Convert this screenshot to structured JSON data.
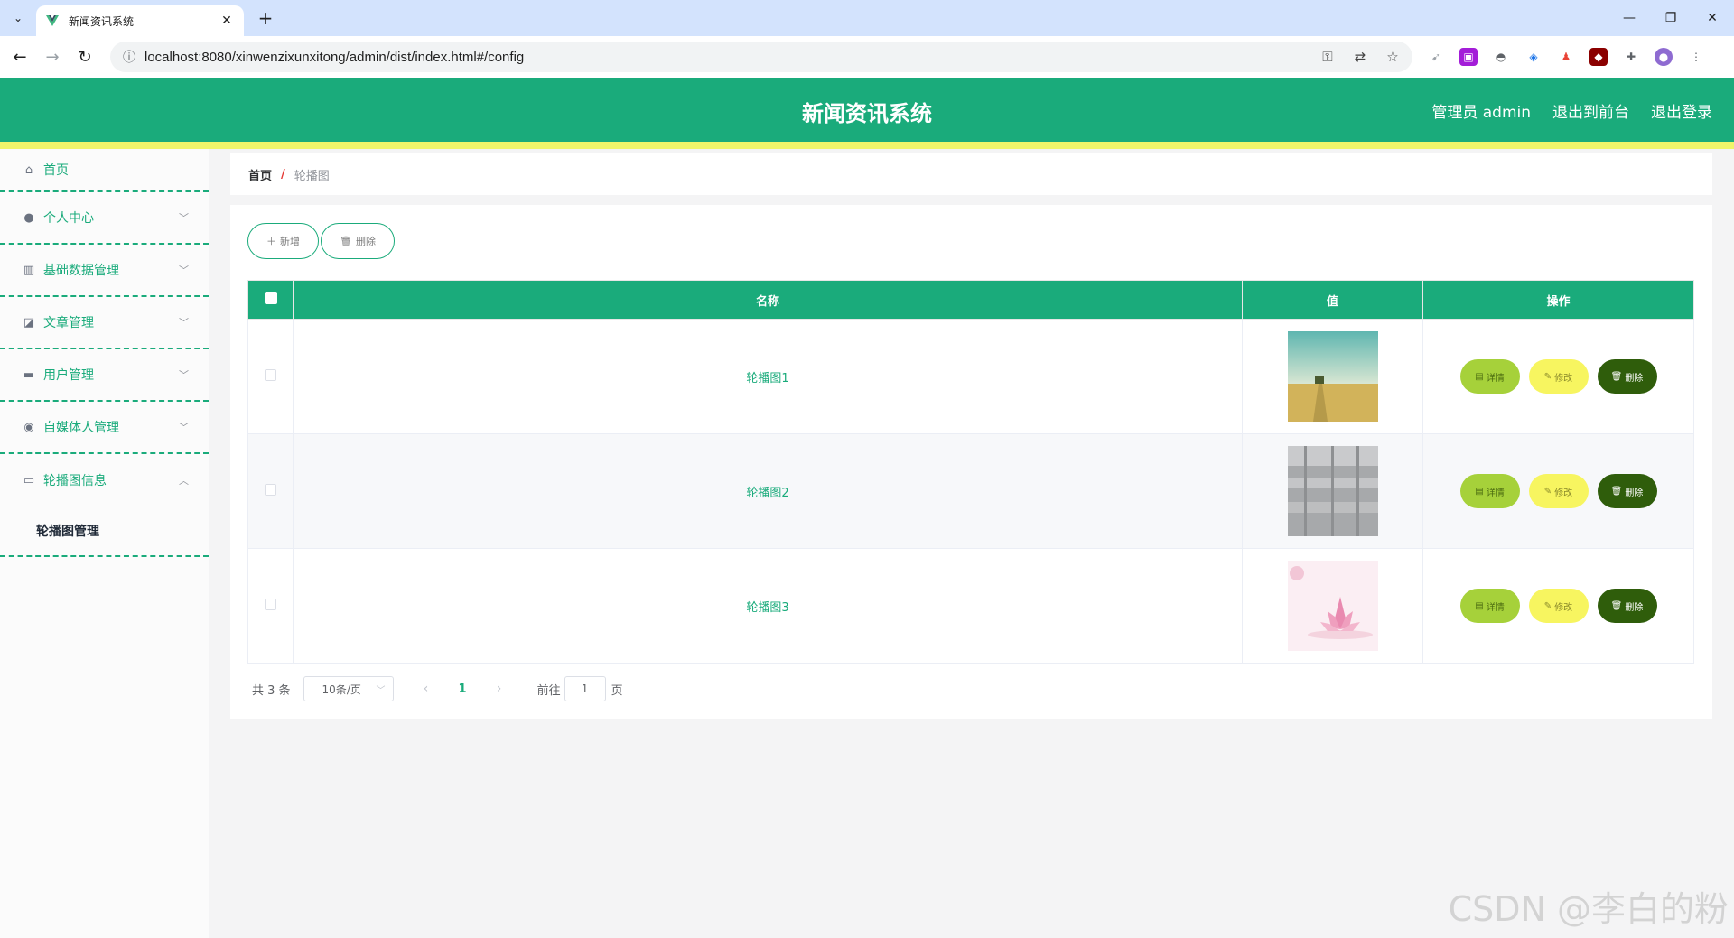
{
  "browser": {
    "tab_title": "新闻资讯系统",
    "url": "localhost:8080/xinwenzixunxitong/admin/dist/index.html#/config"
  },
  "header": {
    "title": "新闻资讯系统",
    "user_label": "管理员 admin",
    "to_front_label": "退出到前台",
    "logout_label": "退出登录",
    "color": "#1aab7b",
    "stripe_color": "#f0f56b"
  },
  "sidebar": {
    "items": [
      {
        "label": "首页",
        "icon": "home-icon"
      },
      {
        "label": "个人中心",
        "icon": "user-icon"
      },
      {
        "label": "基础数据管理",
        "icon": "library-icon"
      },
      {
        "label": "文章管理",
        "icon": "chart-icon"
      },
      {
        "label": "用户管理",
        "icon": "chat-icon"
      },
      {
        "label": "自媒体人管理",
        "icon": "bulb-icon"
      },
      {
        "label": "轮播图信息",
        "icon": "banner-icon"
      }
    ],
    "submenu_label": "轮播图管理"
  },
  "breadcrumb": {
    "home": "首页",
    "separator": "/",
    "current": "轮播图"
  },
  "toolbar": {
    "add_label": "新增",
    "delete_label": "删除"
  },
  "table": {
    "columns": [
      "名称",
      "值",
      "操作"
    ],
    "rows": [
      {
        "name": "轮播图1",
        "image": "field-image"
      },
      {
        "name": "轮播图2",
        "image": "waterfall-image"
      },
      {
        "name": "轮播图3",
        "image": "lotus-image"
      }
    ],
    "actions": {
      "detail": "详情",
      "edit": "修改",
      "delete": "删除"
    }
  },
  "pagination": {
    "total_text": "共 3 条",
    "page_size": "10条/页",
    "current_page": "1",
    "goto_label": "前往",
    "goto_value": "1",
    "page_unit": "页"
  },
  "watermark": "CSDN @李白的粉"
}
